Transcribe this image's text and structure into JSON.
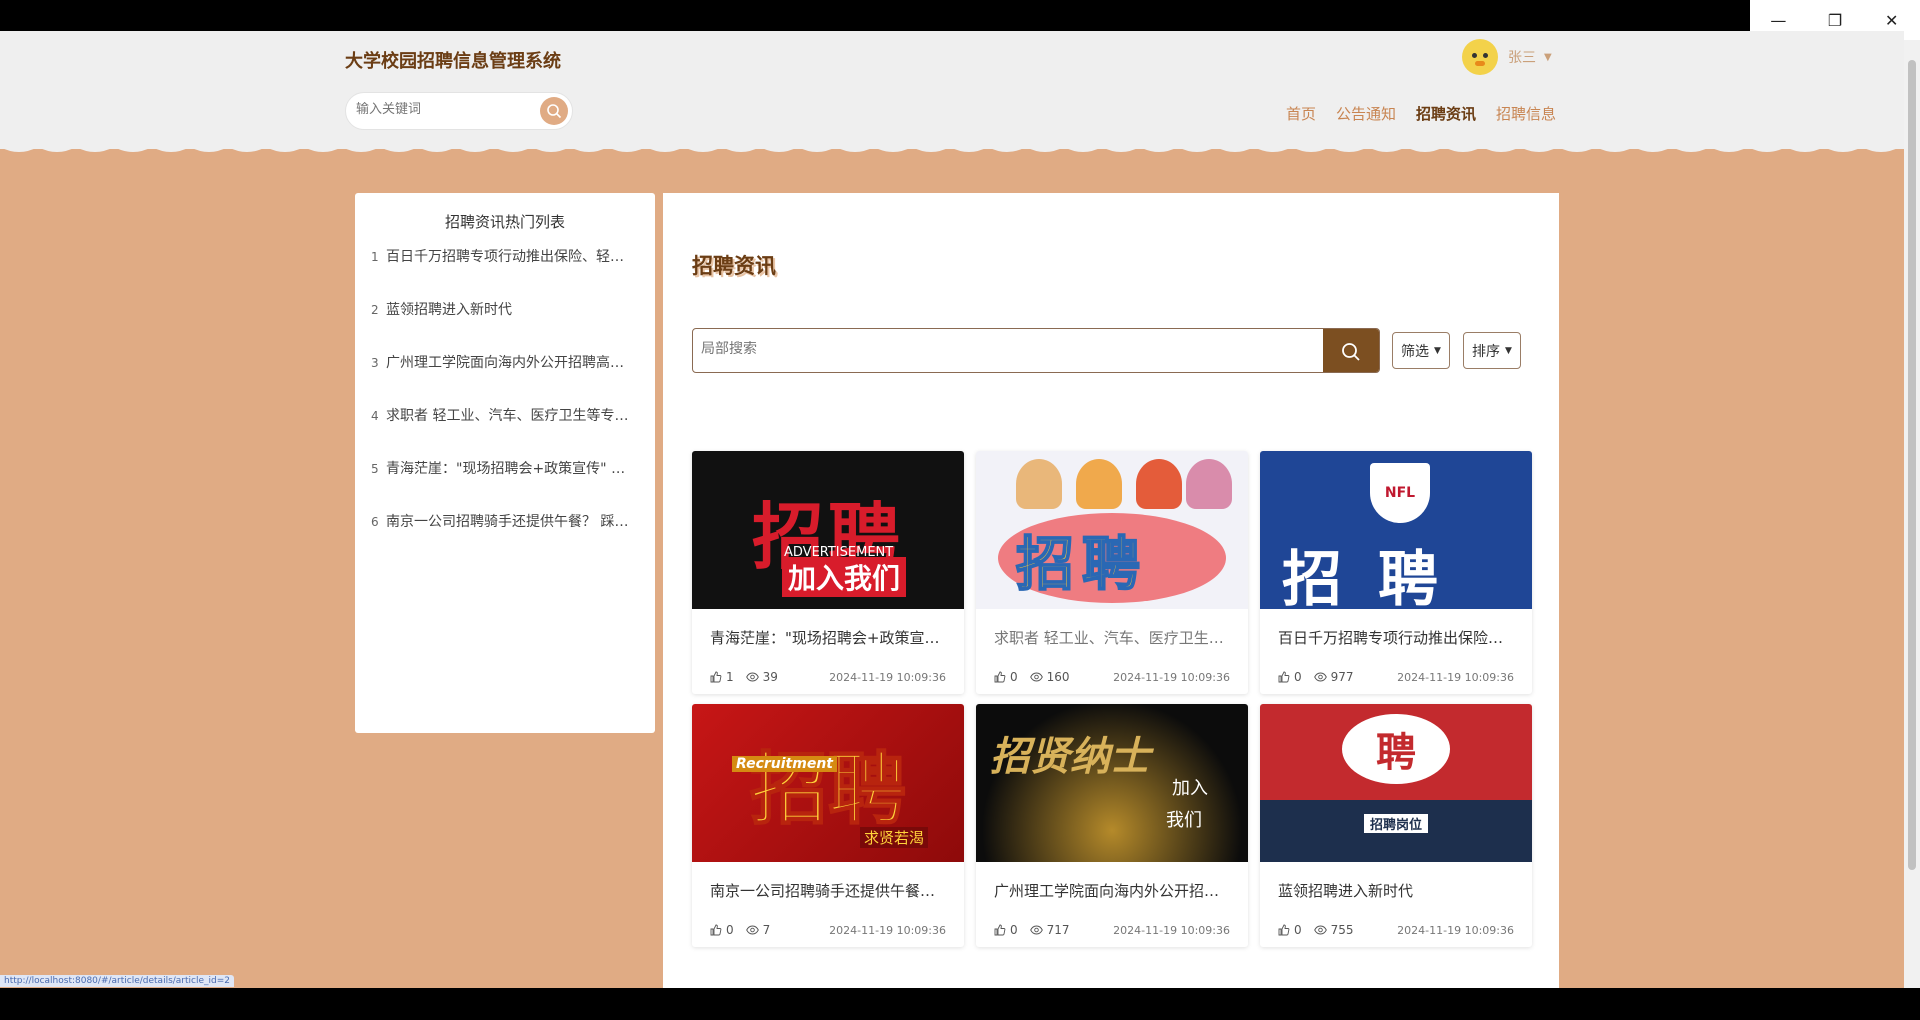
{
  "window": {
    "minimize": "—",
    "restore": "❐",
    "close": "✕"
  },
  "header": {
    "site_title": "大学校园招聘信息管理系统",
    "search_placeholder": "输入关键词",
    "user_name": "张三"
  },
  "nav": {
    "items": [
      {
        "label": "首页"
      },
      {
        "label": "公告通知"
      },
      {
        "label": "招聘资讯",
        "active": true
      },
      {
        "label": "招聘信息"
      }
    ]
  },
  "sidebar": {
    "title": "招聘资讯热门列表",
    "items": [
      {
        "num": "1",
        "text": "百日千万招聘专项行动推出保险、轻工业等…"
      },
      {
        "num": "2",
        "text": "蓝领招聘进入新时代"
      },
      {
        "num": "3",
        "text": "广州理工学院面向海内外公开招聘高层次人才"
      },
      {
        "num": "4",
        "text": "求职者 轻工业、汽车、医疗卫生等专业…"
      },
      {
        "num": "5",
        "text": "青海茫崖：\"现场招聘会+政策宣传\" 实现…"
      },
      {
        "num": "6",
        "text": "南京一公司招聘骑手还提供午餐？ 踩…"
      }
    ]
  },
  "main": {
    "heading": "招聘资讯",
    "search_placeholder": "局部搜索",
    "filter_label": "筛选",
    "sort_label": "排序"
  },
  "cards": [
    {
      "title": "青海茫崖：\"现场招聘会+政策宣传\"实现…",
      "likes": "1",
      "views": "39",
      "date": "2024-11-19 10:09:36",
      "thumb_big": "招聘",
      "thumb_en": "ADVERTISEMENT",
      "thumb_sub": "加入我们"
    },
    {
      "title": "求职者 轻工业、汽车、医疗卫生等专业…",
      "likes": "0",
      "views": "160",
      "date": "2024-11-19 10:09:36",
      "thumb_big": "招聘"
    },
    {
      "title": "百日千万招聘专项行动推出保险、轻工业等…",
      "likes": "0",
      "views": "977",
      "date": "2024-11-19 10:09:36",
      "thumb_big": "招聘",
      "thumb_logo": "NFL"
    },
    {
      "title": "南京一公司招聘骑手还提供午餐？ 踩…",
      "likes": "0",
      "views": "7",
      "date": "2024-11-19 10:09:36",
      "thumb_big": "招聘",
      "thumb_en": "Recruitment",
      "thumb_sub": "求贤若渴"
    },
    {
      "title": "广州理工学院面向海内外公开招聘高层次人才",
      "likes": "0",
      "views": "717",
      "date": "2024-11-19 10:09:36",
      "thumb_big": "招贤纳士",
      "thumb_join": "加入",
      "thumb_men": "我们"
    },
    {
      "title": "蓝领招聘进入新时代",
      "likes": "0",
      "views": "755",
      "date": "2024-11-19 10:09:36",
      "thumb_big": "聘",
      "thumb_tag": "招聘岗位"
    }
  ],
  "status_url": "http://localhost:8080/#/article/details/article_id=2",
  "colors": {
    "accent": "#e0ab84",
    "brand_dark": "#6b3d14",
    "search_button": "#7c4f21"
  }
}
